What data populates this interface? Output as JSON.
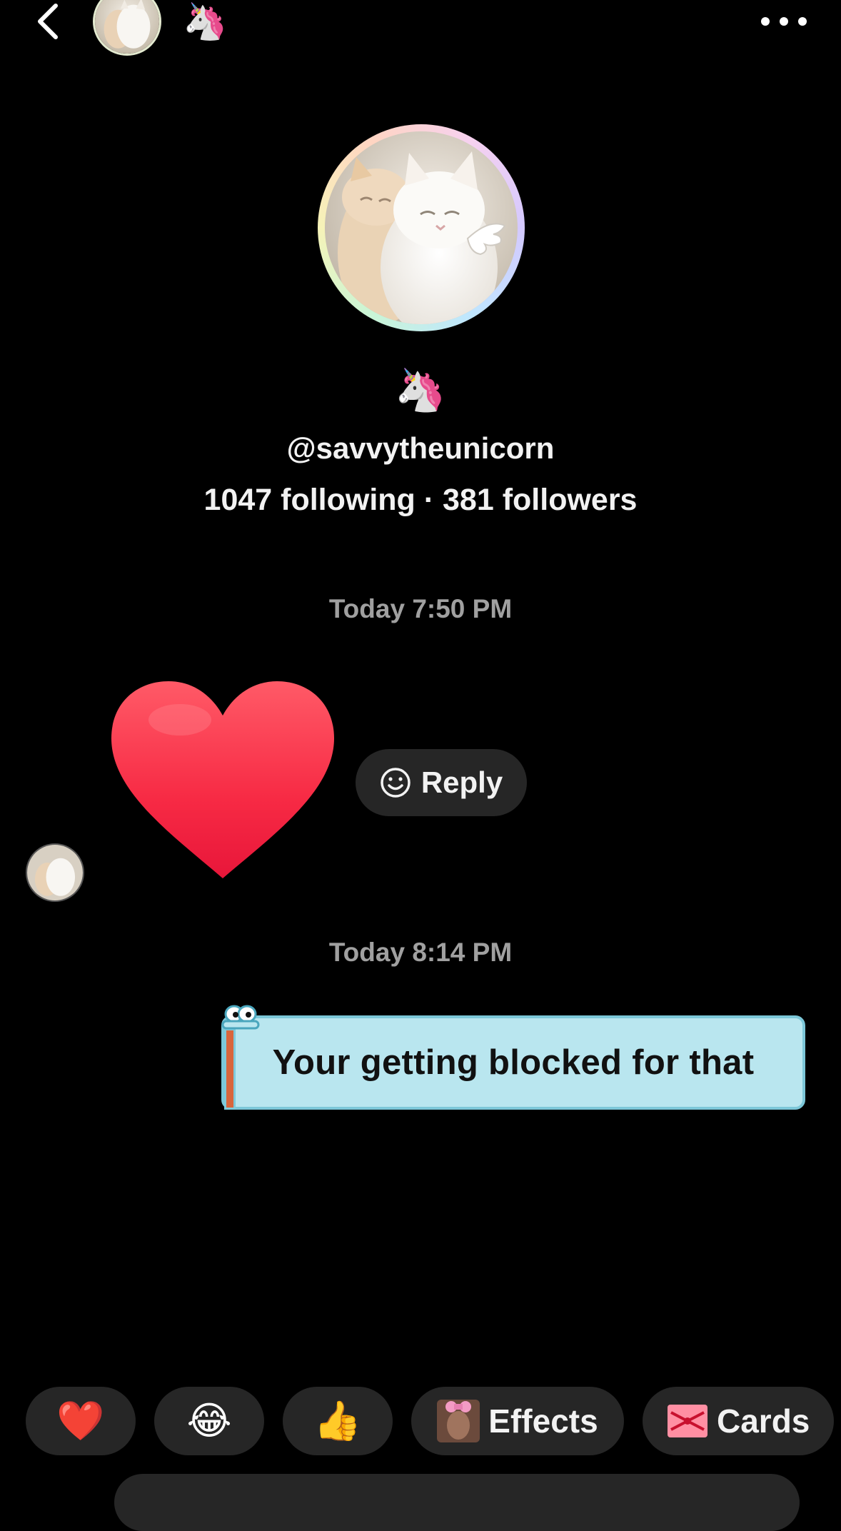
{
  "header": {
    "back_icon": "chevron-left-icon",
    "badge_emoji": "🦄",
    "more_icon": "more-horizontal-icon"
  },
  "profile": {
    "badge_emoji": "🦄",
    "username": "@savvytheunicorn",
    "stats": "1047 following · 381 followers"
  },
  "conversation": {
    "messages": [
      {
        "timestamp": "Today 7:50 PM",
        "type": "heart-emoji",
        "content": "❤️",
        "reply_label": "Reply",
        "reply_icon": "smiley-icon"
      },
      {
        "timestamp": "Today 8:14 PM",
        "type": "text",
        "text": "Your getting blocked for that"
      }
    ]
  },
  "quick_bar": {
    "reactions": [
      "❤️",
      "😂",
      "👍"
    ],
    "effects_label": "Effects",
    "cards_label": "Cards",
    "cards_emoji": "🎀"
  },
  "colors": {
    "background": "#000000",
    "chip": "#262626",
    "bubble": "#b9e6ef",
    "timestamp": "#a0a0a0"
  }
}
